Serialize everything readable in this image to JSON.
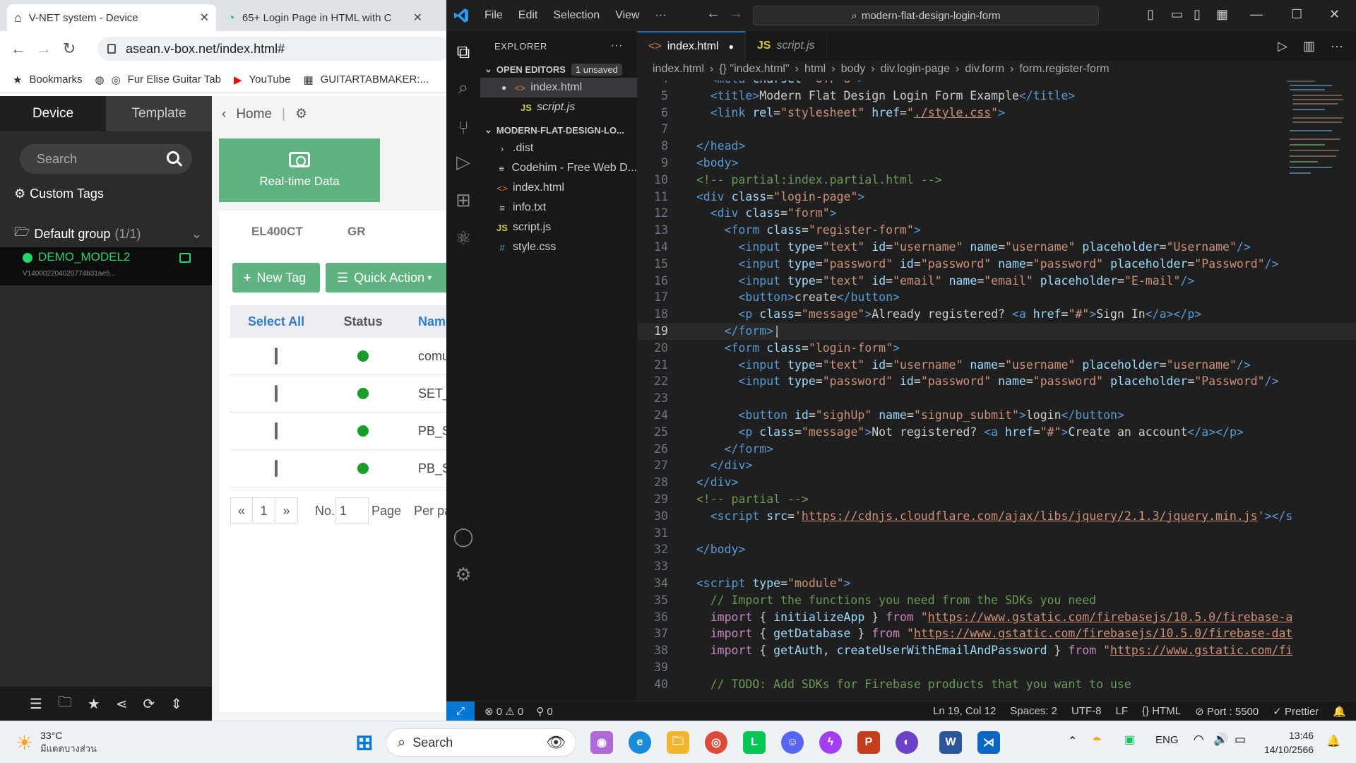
{
  "browser": {
    "tabs": [
      {
        "title": "V-NET system - Device",
        "close": "✕"
      },
      {
        "title": "65+ Login Page in HTML with C",
        "close": "✕"
      }
    ],
    "url": "asean.v-box.net/index.html#",
    "bookmarks": [
      {
        "label": "Bookmarks",
        "icon": "star-icon"
      },
      {
        "label": "Fur Elise Guitar Tab",
        "icon": "globe-icon"
      },
      {
        "label": "YouTube",
        "icon": "youtube-icon"
      },
      {
        "label": "GUITARTABMAKER:...",
        "icon": "tab-icon"
      }
    ]
  },
  "app": {
    "sidebar": {
      "tab_device": "Device",
      "tab_template": "Template",
      "search_placeholder": "Search",
      "custom_tags": "Custom Tags",
      "default_group": "Default group",
      "group_count": "(1/1)",
      "device_name": "DEMO_MODEL2",
      "device_id": "V140002204020774b31ae5..."
    },
    "main": {
      "breadcrumb": "Home",
      "realtime_card": "Real-time Data",
      "subtabs": [
        "EL400CT",
        "GR"
      ],
      "new_tag": "New Tag",
      "quick_action": "Quick Action",
      "table": {
        "headers": [
          "Select All",
          "Status",
          "Name"
        ],
        "rows": [
          {
            "name": "comuni"
          },
          {
            "name": "SET_V"
          },
          {
            "name": "PB_ST"
          },
          {
            "name": "PB_ST"
          }
        ]
      },
      "pager": {
        "prev": "«",
        "page": "1",
        "next": "»",
        "no_label": "No.",
        "no_value": "1",
        "page_label": "Page",
        "per_label": "Per pa"
      }
    }
  },
  "vscode": {
    "menu": [
      "File",
      "Edit",
      "Selection",
      "View",
      "···"
    ],
    "command_center": "modern-flat-design-login-form",
    "explorer": {
      "title": "EXPLORER",
      "open_editors": "OPEN EDITORS",
      "unsaved": "1 unsaved",
      "open_files": [
        "index.html",
        "script.js"
      ],
      "project": "MODERN-FLAT-DESIGN-LO...",
      "files": [
        ".dist",
        "Codehim - Free Web D...",
        "index.html",
        "info.txt",
        "script.js",
        "style.css"
      ]
    },
    "tabs": [
      "index.html",
      "script.js"
    ],
    "breadcrumb": [
      "index.html",
      "{} \"index.html\"",
      "html",
      "body",
      "div.login-page",
      "div.form",
      "form.register-form"
    ],
    "status": {
      "errors": "0",
      "warnings": "0",
      "ports": "0",
      "position": "Ln 19, Col 12",
      "spaces": "Spaces: 2",
      "encoding": "UTF-8",
      "eol": "LF",
      "language": "HTML",
      "port": "Port : 5500",
      "prettier": "Prettier"
    }
  },
  "taskbar": {
    "temp": "33°C",
    "weather": "มีแดดบางส่วน",
    "search": "Search",
    "lang": "ENG",
    "time": "13:46",
    "date": "14/10/2566"
  },
  "colors": {
    "accent_green": "#5fb380",
    "vscode_blue": "#0078d4",
    "device_green": "#27d46c"
  }
}
